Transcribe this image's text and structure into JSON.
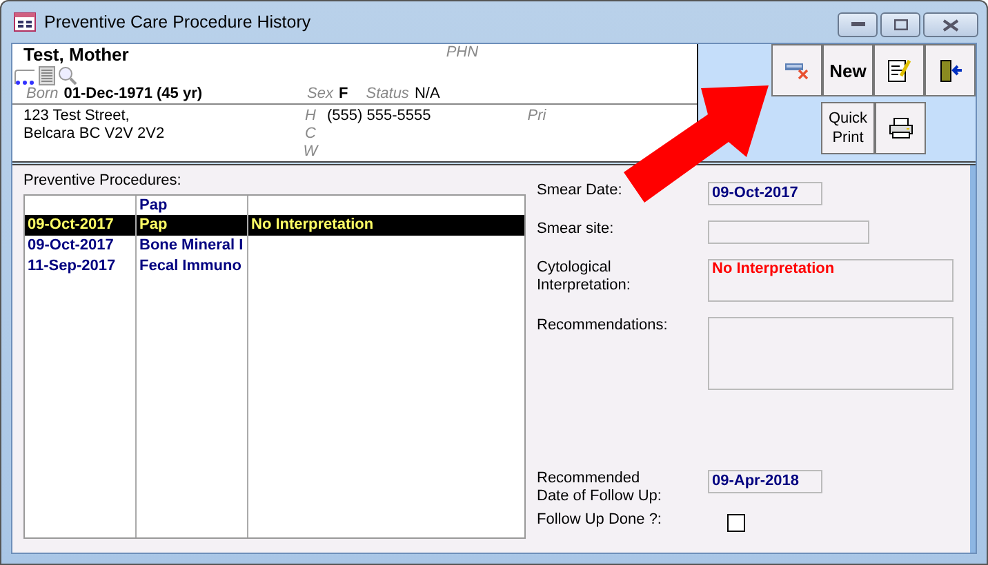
{
  "window": {
    "title": "Preventive Care Procedure History"
  },
  "patient": {
    "name": "Test, Mother",
    "phn_label": "PHN",
    "born_label": "Born",
    "born": "01-Dec-1971 (45 yr)",
    "sex_label": "Sex",
    "sex": "F",
    "status_label": "Status",
    "status": "N/A",
    "address": [
      "123 Test Street,",
      "Belcara BC  V2V 2V2"
    ],
    "phone_labels": [
      "H",
      "C",
      "W"
    ],
    "phone": "(555) 555-5555",
    "pri_label": "Pri"
  },
  "toolbar": [
    {
      "kind": "delete"
    },
    {
      "kind": "text",
      "label": "New"
    },
    {
      "kind": "edit"
    },
    {
      "kind": "exit"
    }
  ],
  "toolbar_2": [
    {
      "kind": "text",
      "label": "Quick Print"
    },
    {
      "kind": "print"
    }
  ],
  "procedures": {
    "label": "Preventive Procedures:",
    "header": {
      "column_2": "Pap"
    },
    "rows": [
      {
        "cells": [
          "09-Oct-2017",
          "Pap",
          "No Interpretation"
        ],
        "selected": true
      },
      {
        "cells": [
          "09-Oct-2017",
          "Bone Mineral I",
          ""
        ],
        "selected": false
      },
      {
        "cells": [
          "11-Sep-2017",
          "Fecal Immuno",
          ""
        ],
        "selected": false
      }
    ]
  },
  "fields": [
    {
      "kind": "date",
      "label": "Smear Date:",
      "value": "09-Oct-2017"
    },
    {
      "kind": "text",
      "label": "Smear site:"
    },
    {
      "kind": "interpretation",
      "label": "Cytological Interpretation:",
      "value": "No Interpretation"
    },
    {
      "kind": "memo",
      "label": "Recommendations:"
    },
    {
      "kind": "date",
      "label": "Recommended  Date of Follow Up:",
      "value": "09-Apr-2018"
    },
    {
      "kind": "checkbox",
      "label": "Follow Up Done ?:",
      "checked": false
    }
  ]
}
